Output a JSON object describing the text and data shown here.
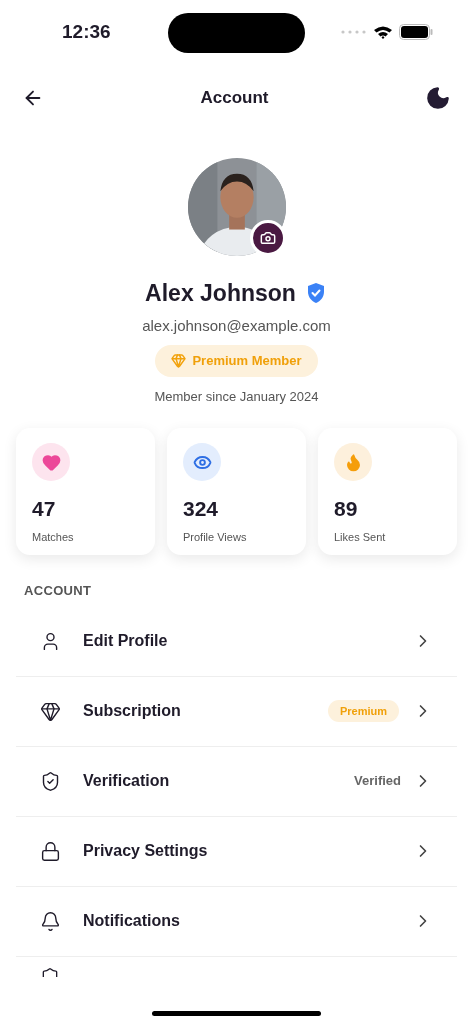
{
  "status_bar": {
    "time": "12:36"
  },
  "header": {
    "title": "Account"
  },
  "profile": {
    "name": "Alex Johnson",
    "verified": true,
    "email": "alex.johnson@example.com",
    "badge": "Premium Member",
    "member_since": "Member since January 2024"
  },
  "stats": [
    {
      "kind": "heart",
      "value": "47",
      "label": "Matches"
    },
    {
      "kind": "eye",
      "value": "324",
      "label": "Profile Views"
    },
    {
      "kind": "flame",
      "value": "89",
      "label": "Likes Sent"
    }
  ],
  "section_title": "ACCOUNT",
  "menu_items": [
    {
      "kind": "plain",
      "label": "Edit Profile"
    },
    {
      "kind": "badge",
      "label": "Subscription",
      "badge": "Premium"
    },
    {
      "kind": "value",
      "label": "Verification",
      "value": "Verified"
    },
    {
      "kind": "plain",
      "label": "Privacy Settings"
    },
    {
      "kind": "plain",
      "label": "Notifications"
    },
    {
      "kind": "cut"
    }
  ]
}
